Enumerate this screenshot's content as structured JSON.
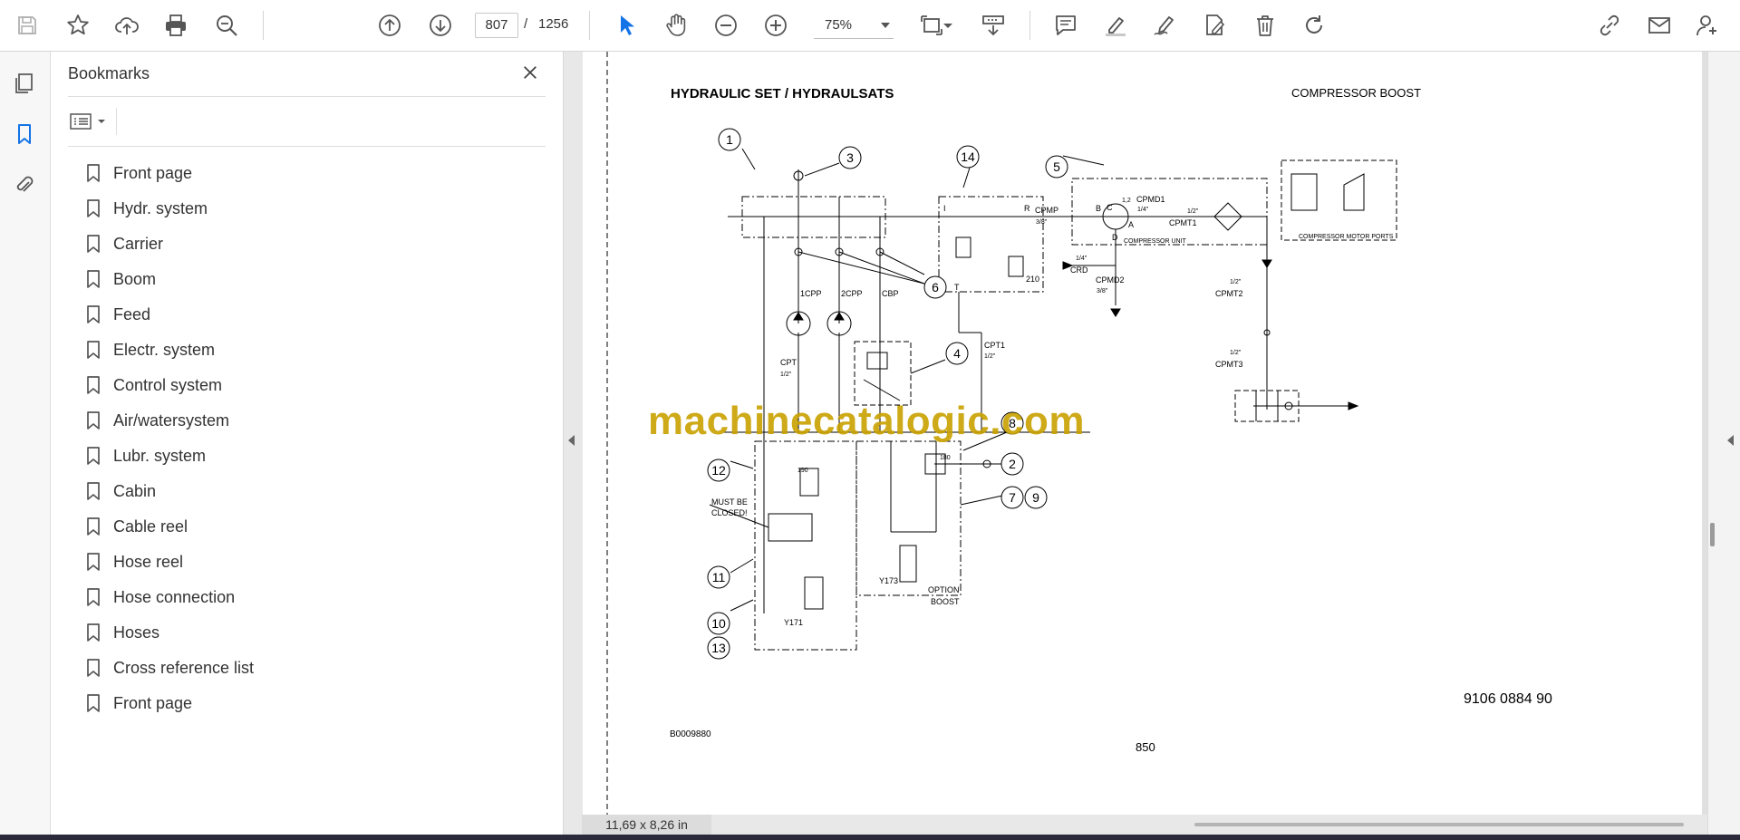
{
  "toolbar": {
    "page_current": "807",
    "page_separator": "/",
    "page_total": "1256",
    "zoom": "75%",
    "icons": [
      "save-icon",
      "bookmark-star-icon",
      "upload-cloud-icon",
      "print-icon",
      "find-zoom-icon",
      "page-up-icon",
      "page-down-icon",
      "select-arrow-icon",
      "hand-icon",
      "zoom-out-icon",
      "zoom-in-icon",
      "fit-page-icon",
      "scroll-mode-icon",
      "comment-icon",
      "highlight-pen-icon",
      "sign-icon",
      "fill-sign-icon",
      "delete-icon",
      "rotate-icon",
      "share-link-icon",
      "email-icon",
      "account-icon"
    ],
    "accent_color": "#1473e6"
  },
  "left_rail": {
    "icons": [
      "pages-icon",
      "bookmarks-icon",
      "attachments-icon"
    ]
  },
  "bookmarks": {
    "title": "Bookmarks",
    "items": [
      {
        "label": "Front page"
      },
      {
        "label": "Hydr. system"
      },
      {
        "label": "Carrier"
      },
      {
        "label": "Boom"
      },
      {
        "label": "Feed"
      },
      {
        "label": "Electr. system"
      },
      {
        "label": "Control system"
      },
      {
        "label": "Air/watersystem"
      },
      {
        "label": "Lubr. system"
      },
      {
        "label": "Cabin"
      },
      {
        "label": "Cable reel"
      },
      {
        "label": "Hose reel"
      },
      {
        "label": "Hose connection"
      },
      {
        "label": "Hoses"
      },
      {
        "label": "Cross reference list"
      },
      {
        "label": "Front page"
      }
    ]
  },
  "document": {
    "title": "HYDRAULIC SET / HYDRAULSATS",
    "subtitle": "COMPRESSOR BOOST",
    "doc_number": "9106 0884 90",
    "figure_id": "B0009880",
    "page_number": "850",
    "watermark": "machinecatalogic.com",
    "callouts": [
      "1",
      "3",
      "14",
      "5",
      "6",
      "4",
      "8",
      "2",
      "7",
      "9",
      "12",
      "11",
      "10",
      "13"
    ],
    "labels": {
      "cpmp": "CPMP",
      "cpmp_size": "3/8\"",
      "cpmd1": "CPMD1",
      "cpmd1_size": "1/4\"",
      "cpmt1": "CPMT1",
      "cpmt1_size": "1/2\"",
      "cpmd2": "CPMD2",
      "cpmd2_size": "3/8\"",
      "crd": "CRD",
      "crd_size": "1/4\"",
      "cpmt2": "CPMT2",
      "cpmt2_size": "1/2\"",
      "cpmt3": "CPMT3",
      "cpmt3_size": "1/2\"",
      "cpt": "CPT",
      "cpt_size": "1/2\"",
      "cpt1": "CPT1",
      "cpt1_size": "1/2\"",
      "p1cpp": "1CPP",
      "p2cpp": "2CPP",
      "cbp": "CBP",
      "port_size": "3/8\"",
      "compressor_unit": "COMPRESSOR UNIT",
      "motor_ports": "COMPRESSOR MOTOR PORTS",
      "must_be_closed_1": "MUST BE",
      "must_be_closed_2": "CLOSED!",
      "y171": "Y171",
      "y173": "Y173",
      "option": "OPTION",
      "boost": "BOOST",
      "v210": "210",
      "v190": "190",
      "v180": "180",
      "port_i": "I",
      "port_r": "R",
      "port_t": "T",
      "port_b": "B",
      "port_c": "C",
      "port_a": "A",
      "port_d": "D",
      "port_12": "1,2"
    }
  },
  "status": {
    "page_size": "11,69 x 8,26 in"
  }
}
